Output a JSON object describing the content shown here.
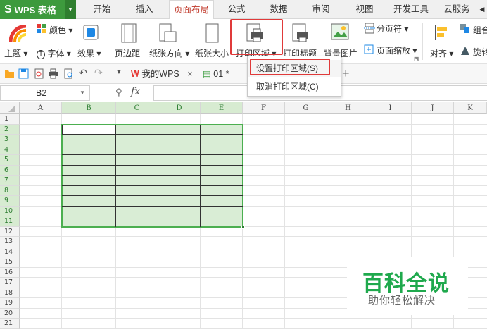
{
  "app": {
    "name": "WPS 表格"
  },
  "tabs": [
    "开始",
    "插入",
    "页面布局",
    "公式",
    "数据",
    "审阅",
    "视图",
    "开发工具",
    "云服务"
  ],
  "active_tab": "页面布局",
  "ribbon": {
    "theme": "主题",
    "color": "颜色",
    "font": "字体",
    "effects": "效果",
    "margins": "页边距",
    "orientation": "纸张方向",
    "size": "纸张大小",
    "print_area": "打印区域",
    "print_titles": "打印标题",
    "background": "背景图片",
    "page_break": "分页符",
    "page_zoom": "页面缩放",
    "align": "对齐",
    "group": "组合",
    "rotate": "旋转"
  },
  "quick_access": {
    "wps_tab": "我的WPS",
    "doc_tab": "01 *"
  },
  "formula_bar": {
    "cell_ref": "B2",
    "fx": "fx"
  },
  "columns": [
    "A",
    "B",
    "C",
    "D",
    "E",
    "F",
    "G",
    "H",
    "I",
    "J",
    "K"
  ],
  "rows": [
    "1",
    "2",
    "3",
    "4",
    "5",
    "6",
    "7",
    "8",
    "9",
    "10",
    "11",
    "12",
    "13",
    "14",
    "15",
    "16",
    "17",
    "18",
    "19",
    "20",
    "21"
  ],
  "dropdown": {
    "set_print_area": "设置打印区域(S)",
    "clear_print_area": "取消打印区域(C)"
  },
  "watermark": {
    "title": "百科全说",
    "subtitle": "助你轻松解决"
  },
  "colors": {
    "accent": "#3d9a3d",
    "highlight": "#e03a3a",
    "selection": "#d9edd5"
  }
}
